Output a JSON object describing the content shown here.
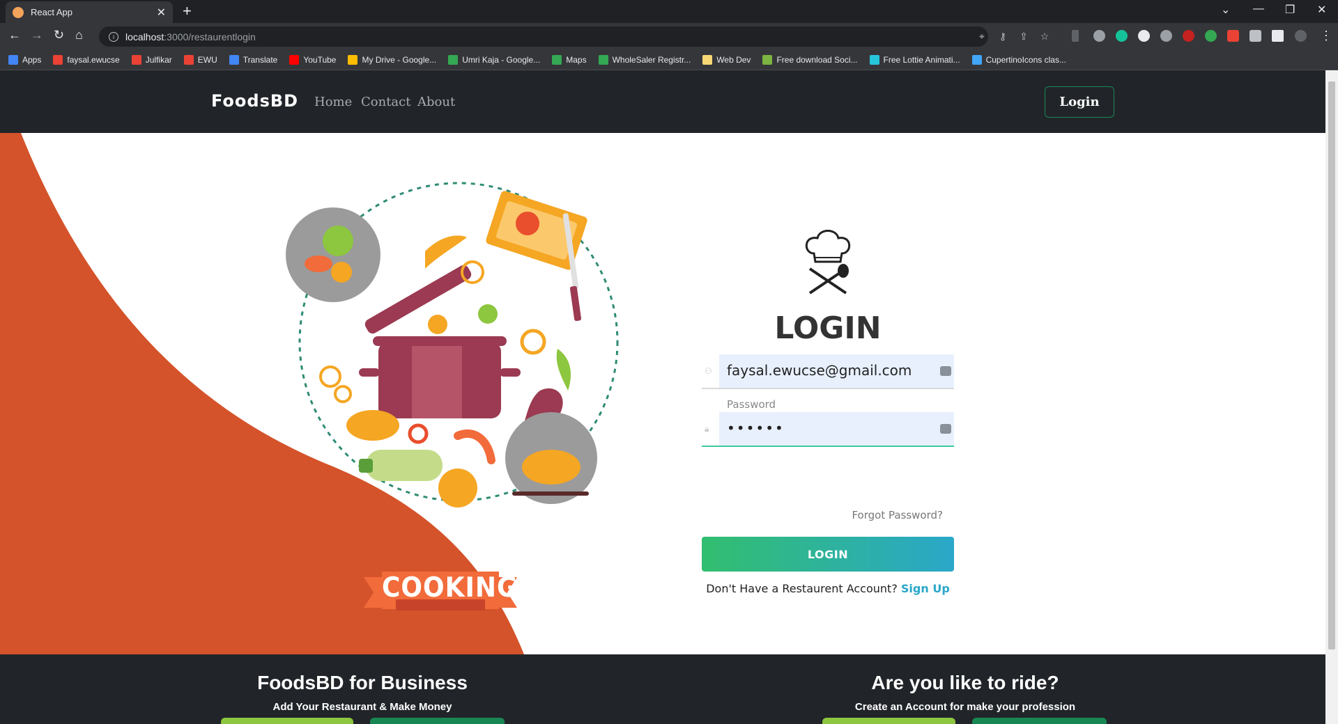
{
  "browser": {
    "tab_title": "React App",
    "new_tab": "+",
    "url_host": "localhost",
    "url_path": ":3000/restaurentlogin",
    "bookmarks": [
      {
        "label": "Apps",
        "color": "#4285f4"
      },
      {
        "label": "faysal.ewucse",
        "color": "#ea4335"
      },
      {
        "label": "Julfikar",
        "color": "#ea4335"
      },
      {
        "label": "EWU",
        "color": "#ea4335"
      },
      {
        "label": "Translate",
        "color": "#4285f4"
      },
      {
        "label": "YouTube",
        "color": "#ff0000"
      },
      {
        "label": "My Drive - Google...",
        "color": "#fbbc04"
      },
      {
        "label": "Umri Kaja - Google...",
        "color": "#34a853"
      },
      {
        "label": "Maps",
        "color": "#34a853"
      },
      {
        "label": "WholeSaler Registr...",
        "color": "#34a853"
      },
      {
        "label": "Web Dev",
        "color": "#f7d774"
      },
      {
        "label": "Free download Soci...",
        "color": "#7cb342"
      },
      {
        "label": "Free Lottie Animati...",
        "color": "#26c6da"
      },
      {
        "label": "CupertinoIcons clas...",
        "color": "#42a5f5"
      }
    ]
  },
  "navbar": {
    "brand": "FoodsBD",
    "links": [
      "Home",
      "Contact",
      "About"
    ],
    "login_button": "Login"
  },
  "login": {
    "title": "LOGIN",
    "email_value": "faysal.ewucse@gmail.com",
    "password_label": "Password",
    "password_value": "••••••",
    "forgot": "Forgot Password?",
    "submit": "LOGIN",
    "signup_prompt": "Don't Have a Restaurent Account?",
    "signup_link": "Sign Up"
  },
  "illustration": {
    "banner_text": "COOKING"
  },
  "footer": {
    "business_title": "FoodsBD for Business",
    "business_sub": "Add Your Restaurant & Make Money",
    "ride_title": "Are you like to ride?",
    "ride_sub": "Create an Account for make your profession"
  },
  "colors": {
    "accent_orange": "#d4532a",
    "login_gradient_start": "#32be6f",
    "login_gradient_end": "#2aa7c9",
    "dark_nav": "#212529",
    "link_teal": "#2aa7c9"
  }
}
